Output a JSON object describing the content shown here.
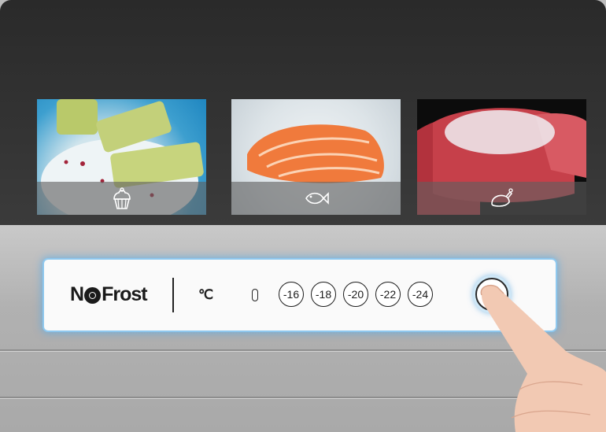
{
  "compartments": [
    {
      "id": "dessert",
      "icon": "cupcake-icon"
    },
    {
      "id": "fish",
      "icon": "fish-icon"
    },
    {
      "id": "poultry",
      "icon": "chicken-icon"
    }
  ],
  "panel": {
    "brand_prefix": "N",
    "brand_suffix": "Frost",
    "unit": "℃",
    "temperatures": [
      "-16",
      "-18",
      "-20",
      "-22",
      "-24"
    ]
  },
  "colors": {
    "panel_glow": "#5aaae6",
    "upper_panel": "#2f2f2f",
    "body": "#b5b5b5"
  }
}
